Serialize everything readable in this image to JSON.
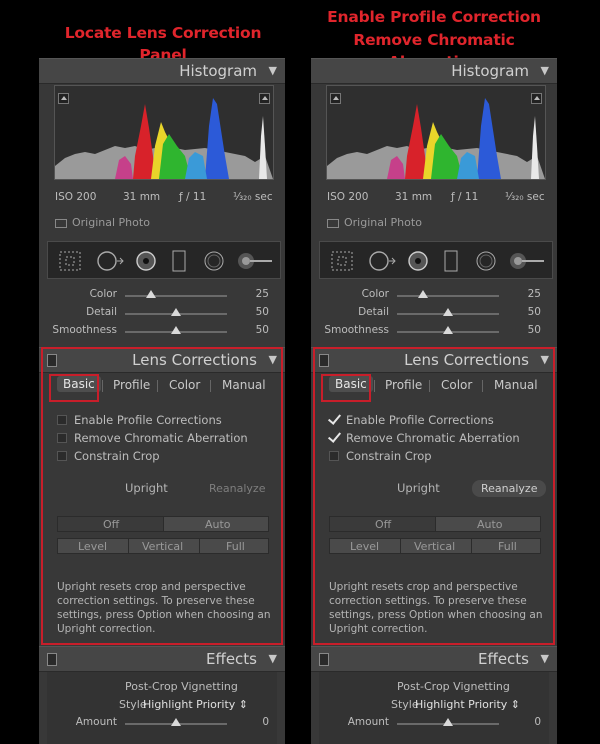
{
  "captions": {
    "left": "Locate Lens Correction Panel",
    "right_line1": "Enable Profile Correction",
    "right_line2": "Remove Chromatic Aberration"
  },
  "histogram": {
    "title": "Histogram",
    "iso": "ISO 200",
    "focal": "31 mm",
    "aperture": "ƒ / 11",
    "shutter": "¹⁄₃₂₀ sec",
    "original_photo": "Original Photo"
  },
  "detail_sliders": [
    {
      "label": "Color",
      "value": "25",
      "pos": 0.25
    },
    {
      "label": "Detail",
      "value": "50",
      "pos": 0.5
    },
    {
      "label": "Smoothness",
      "value": "50",
      "pos": 0.5
    }
  ],
  "lens": {
    "title": "Lens Corrections",
    "tabs": [
      "Basic",
      "Profile",
      "Color",
      "Manual"
    ],
    "checks": [
      "Enable Profile Corrections",
      "Remove Chromatic Aberration",
      "Constrain Crop"
    ],
    "upright_label": "Upright",
    "reanalyze": "Reanalyze",
    "seg_row1": [
      "Off",
      "Auto"
    ],
    "seg_row2": [
      "Level",
      "Vertical",
      "Full"
    ],
    "description": "Upright resets crop and perspective correction settings. To preserve these settings, press Option when choosing an Upright correction."
  },
  "left_state": {
    "checks": [
      false,
      false,
      false
    ]
  },
  "right_state": {
    "checks": [
      true,
      true,
      false
    ]
  },
  "effects": {
    "title": "Effects",
    "vignetting": "Post-Crop Vignetting",
    "style_label": "Style",
    "style_value": "Highlight Priority ⇕",
    "amount_label": "Amount",
    "amount_value": "0"
  },
  "colors": {
    "highlight": "#c81e2a",
    "caption": "#e0252c",
    "panel": "#383838"
  }
}
